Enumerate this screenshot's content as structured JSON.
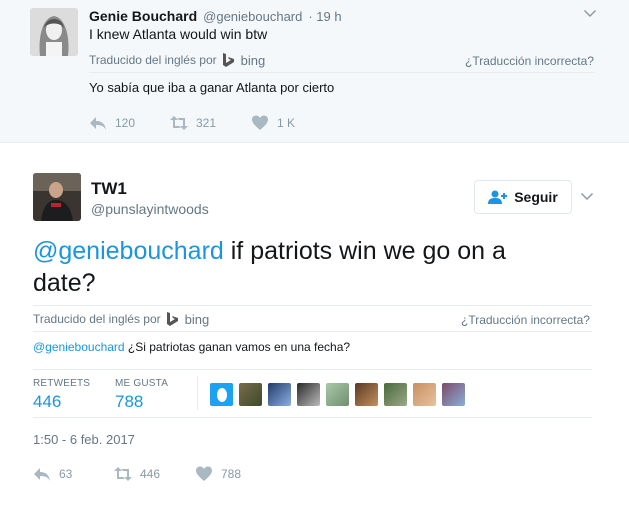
{
  "tweet1": {
    "name": "Genie Bouchard",
    "handle": "@geniebouchard",
    "time": "· 19 h",
    "text": "I knew Atlanta would win btw",
    "translated_by": "Traducido del inglés por",
    "bing": "bing",
    "wrong_translation": "¿Traducción incorrecta?",
    "translation": "Yo sabía que iba a ganar Atlanta por cierto",
    "reply_count": "120",
    "retweet_count": "321",
    "like_count": "1 K"
  },
  "tweet2": {
    "name": "TW1",
    "handle": "@punslayintwoods",
    "follow_label": "Seguir",
    "mention": "@geniebouchard",
    "text_rest": " if patriots win we go on a date?",
    "translated_by": "Traducido del inglés por",
    "bing": "bing",
    "wrong_translation": "¿Traducción incorrecta?",
    "translation_mention": "@geniebouchard",
    "translation_rest": " ¿Si patriotas ganan vamos en una fecha?",
    "retweets_label": "RETWEETS",
    "retweets_value": "446",
    "likes_label": "ME GUSTA",
    "likes_value": "788",
    "timestamp": "1:50 - 6 feb. 2017",
    "reply_count": "63",
    "retweet_count": "446",
    "like_count": "788"
  },
  "colors": {
    "link": "#1b95e0",
    "muted": "#657786",
    "icon": "#aab8c2",
    "top_bg": "#f5f8fa"
  }
}
